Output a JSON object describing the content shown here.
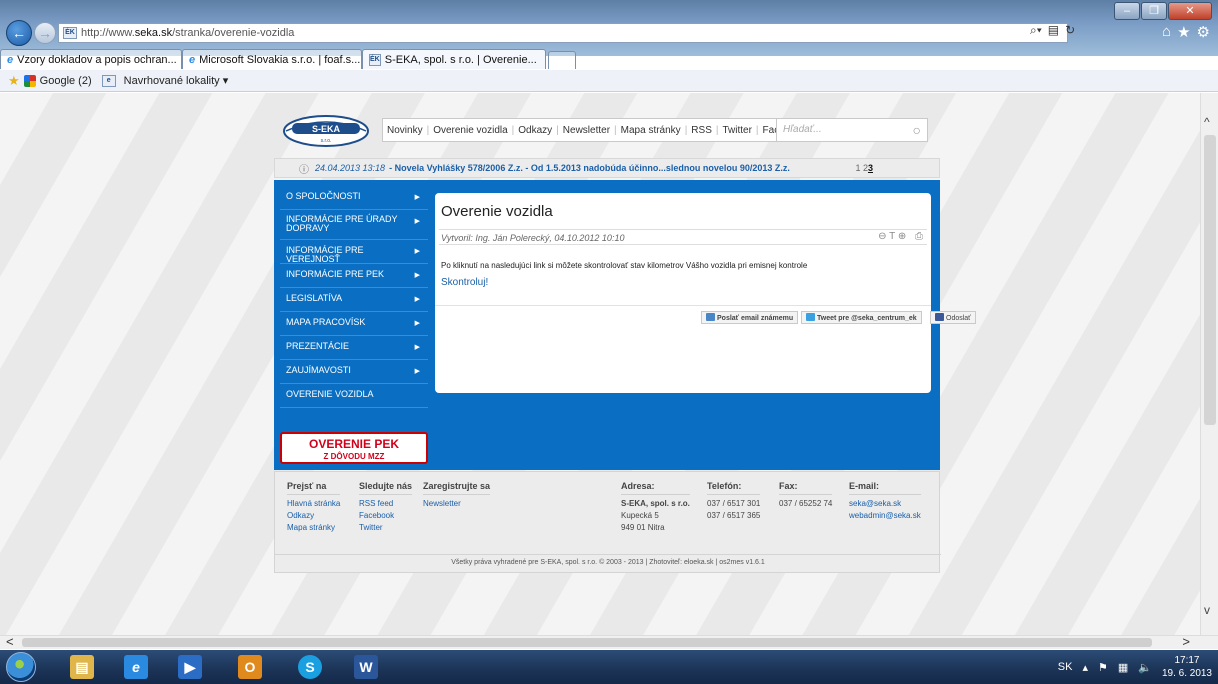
{
  "browser": {
    "address_url_prefix": "http://www.",
    "address_url_domain": "seka.sk",
    "address_url_path": "/stranka/overenie-vozidla",
    "tabs": [
      {
        "label": "Vzory dokladov a popis ochran..."
      },
      {
        "label": "Microsoft Slovakia s.r.o. | foaf.s..."
      },
      {
        "label": "S-EKA, spol. s r.o. | Overenie...",
        "close": "×"
      }
    ],
    "favorites": {
      "google": "Google (2)",
      "suggested": "Navrhované lokality ▾"
    }
  },
  "site": {
    "logo_text": "S-EKA",
    "logo_sub": "s.r.o.",
    "nav": [
      "Novinky",
      "Overenie vozidla",
      "Odkazy",
      "Newsletter",
      "Mapa stránky",
      "RSS",
      "Twitter",
      "Facebook"
    ],
    "search_placeholder": "Hľadať...",
    "news": {
      "date": "24.04.2013 13:18",
      "headline": "- Novela Vyhlášky 578/2006 Z.z. - Od 1.5.2013 nadobúda účinno...slednou novelou 90/2013 Z.z.",
      "pager_prefix": "1 2",
      "pager_current": "3"
    },
    "sidemenu": [
      "O SPOLOČNOSTI",
      "INFORMÁCIE PRE ÚRADY DOPRAVY",
      "INFORMÁCIE PRE VEREJNOSŤ",
      "INFORMÁCIE PRE PEK",
      "LEGISLATÍVA",
      "MAPA PRACOVÍSK",
      "PREZENTÁCIE",
      "ZAUJÍMAVOSTI",
      "OVERENIE VOZIDLA"
    ],
    "pek_button": {
      "line1": "OVERENIE PEK",
      "line2": "Z DÔVODU MZZ"
    },
    "content": {
      "title": "Overenie vozidla",
      "meta": "Vytvoril: Ing. Ján Polerecký, 04.10.2012 10:10",
      "text": "Po kliknutí na nasledujúci link si môžete skontrolovať stav kilometrov Vášho vozidla pri emisnej kontrole",
      "link": "Skontroluj!",
      "share_email": "Poslať email známemu",
      "share_tweet": "Tweet pre @seka_centrum_ek",
      "share_fb": "Odoslať"
    },
    "footer": {
      "col1": {
        "h": "Prejsť na",
        "items": [
          "Hlavná stránka",
          "Odkazy",
          "Mapa stránky"
        ]
      },
      "col2": {
        "h": "Sledujte nás",
        "items": [
          "RSS feed",
          "Facebook",
          "Twitter"
        ]
      },
      "col3": {
        "h": "Zaregistrujte sa",
        "items": [
          "Newsletter"
        ]
      },
      "col4": {
        "h": "Adresa:",
        "items": [
          "S-EKA, spol. s r.o.",
          "Kupecká 5",
          "949 01 Nitra"
        ]
      },
      "col5": {
        "h": "Telefón:",
        "items": [
          "037 / 6517 301",
          "037 / 6517 365"
        ]
      },
      "col6": {
        "h": "Fax:",
        "items": [
          "037 / 65252 74"
        ]
      },
      "col7": {
        "h": "E-mail:",
        "items": [
          "seka@seka.sk",
          "webadmin@seka.sk"
        ]
      },
      "copyright": "Všetky práva vyhradené pre S-EKA, spol. s r.o. © 2003 - 2013 | Zhotoviteľ: eloeka.sk | os2mes v1.6.1"
    }
  },
  "taskbar": {
    "lang": "SK",
    "time": "17:17",
    "date": "19. 6. 2013"
  },
  "colors": {
    "site_blue": "#0a6fc2",
    "link": "#1a5fa8",
    "pek_red": "#d0021b"
  }
}
